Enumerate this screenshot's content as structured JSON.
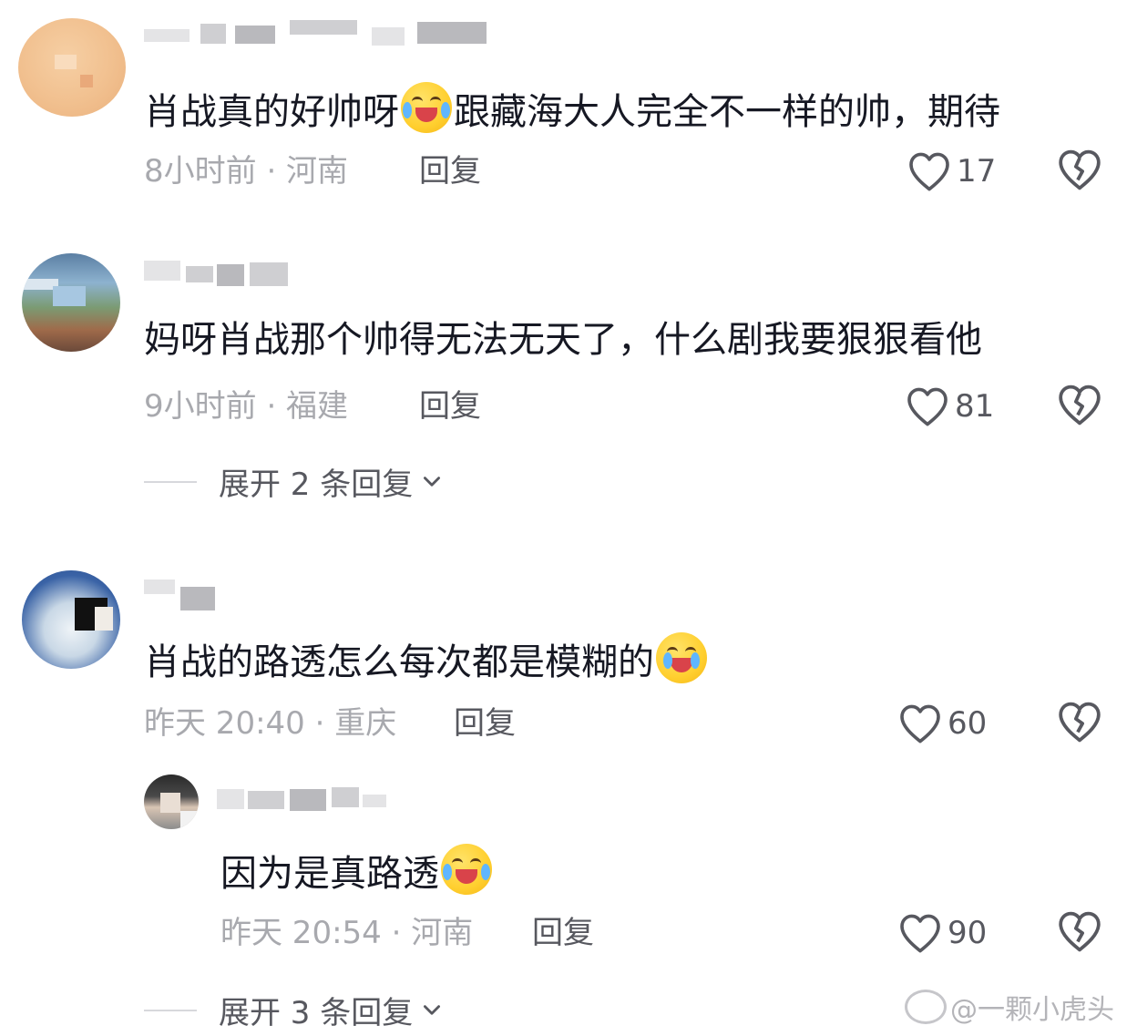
{
  "comments": [
    {
      "content_a": "肖战真的好帅呀",
      "content_b": "跟藏海大人完全不一样的帅，期待",
      "time_loc": "8小时前 · 河南",
      "reply_label": "回复",
      "likes": "17"
    },
    {
      "content": "妈呀肖战那个帅得无法无天了，什么剧我要狠狠看他",
      "time_loc": "9小时前 · 福建",
      "reply_label": "回复",
      "likes": "81",
      "expand": "展开 2 条回复"
    },
    {
      "content": "肖战的路透怎么每次都是模糊的",
      "time_loc": "昨天 20:40 · 重庆",
      "reply_label": "回复",
      "likes": "60",
      "subreply": {
        "content": "因为是真路透",
        "time_loc": "昨天 20:54 · 河南",
        "reply_label": "回复",
        "likes": "90"
      },
      "expand": "展开 3 条回复"
    }
  ],
  "watermark": "@一颗小虎头",
  "colors": {
    "text": "#161823",
    "meta": "#a8a9ae",
    "action": "#57585f"
  },
  "icons": [
    "heart-outline-icon",
    "broken-heart-icon",
    "chevron-down-icon",
    "weibo-logo-icon",
    "crying-laughing-emoji",
    "loudly-crying-emoji"
  ]
}
